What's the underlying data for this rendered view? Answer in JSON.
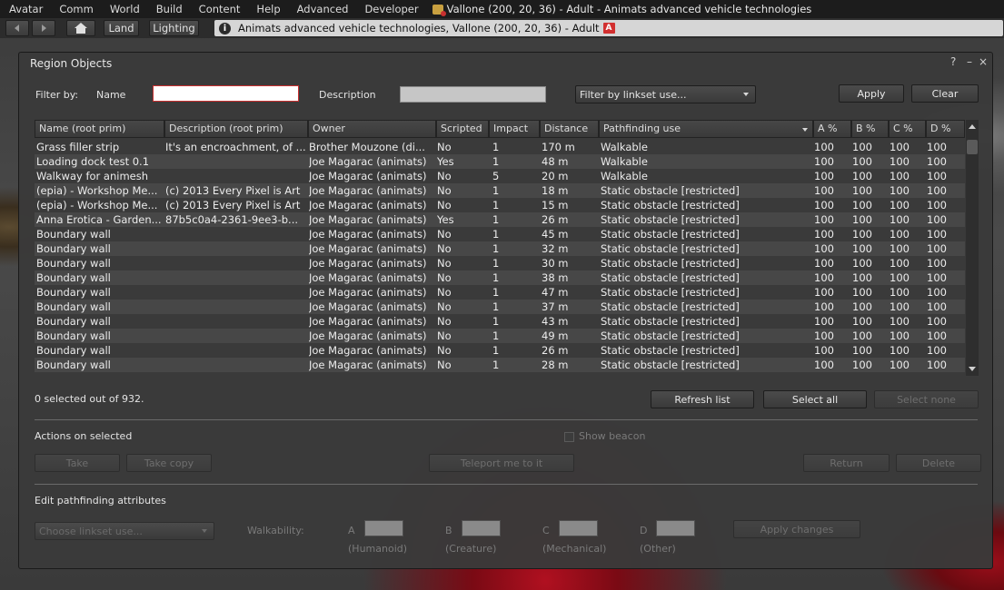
{
  "menu": [
    "Avatar",
    "Comm",
    "World",
    "Build",
    "Content",
    "Help",
    "Advanced",
    "Developer"
  ],
  "location_title": "Vallone (200, 20, 36) - Adult - Animats advanced vehicle technologies",
  "navbar": {
    "land_label": "Land",
    "lighting_label": "Lighting",
    "address": "Animats advanced vehicle technologies, Vallone (200, 20, 36) - Adult",
    "maturity_badge": "A"
  },
  "window": {
    "title": "Region Objects",
    "help": "?",
    "minimize": "–",
    "close": "×"
  },
  "filter": {
    "filter_by_label": "Filter by:",
    "name_label": "Name",
    "name_value": "",
    "description_label": "Description",
    "description_value": "",
    "linkset_use": "Filter by linkset use...",
    "apply_label": "Apply",
    "clear_label": "Clear"
  },
  "table": {
    "columns": [
      "Name (root prim)",
      "Description (root prim)",
      "Owner",
      "Scripted",
      "Impact",
      "Distance",
      "Pathfinding use",
      "A %",
      "B %",
      "C %",
      "D %"
    ],
    "rows": [
      [
        "Grass filler strip",
        "It's an encroachment, of ...",
        "Brother Mouzone (di...",
        "No",
        "1",
        "170 m",
        "Walkable",
        "100",
        "100",
        "100",
        "100"
      ],
      [
        "Loading dock test 0.1",
        "",
        "Joe Magarac (animats)",
        "Yes",
        "1",
        "48 m",
        "Walkable",
        "100",
        "100",
        "100",
        "100"
      ],
      [
        "Walkway for animesh",
        "",
        "Joe Magarac (animats)",
        "No",
        "5",
        "20 m",
        "Walkable",
        "100",
        "100",
        "100",
        "100"
      ],
      [
        "(epia) - Workshop Me...",
        "(c) 2013 Every Pixel is Art",
        "Joe Magarac (animats)",
        "No",
        "1",
        "18 m",
        "Static obstacle [restricted]",
        "100",
        "100",
        "100",
        "100"
      ],
      [
        "(epia) - Workshop Me...",
        "(c) 2013 Every Pixel is Art",
        "Joe Magarac (animats)",
        "No",
        "1",
        "15 m",
        "Static obstacle [restricted]",
        "100",
        "100",
        "100",
        "100"
      ],
      [
        "Anna Erotica - Garden...",
        "87b5c0a4-2361-9ee3-b...",
        "Joe Magarac (animats)",
        "Yes",
        "1",
        "26 m",
        "Static obstacle [restricted]",
        "100",
        "100",
        "100",
        "100"
      ],
      [
        "Boundary wall",
        "",
        "Joe Magarac (animats)",
        "No",
        "1",
        "45 m",
        "Static obstacle [restricted]",
        "100",
        "100",
        "100",
        "100"
      ],
      [
        "Boundary wall",
        "",
        "Joe Magarac (animats)",
        "No",
        "1",
        "32 m",
        "Static obstacle [restricted]",
        "100",
        "100",
        "100",
        "100"
      ],
      [
        "Boundary wall",
        "",
        "Joe Magarac (animats)",
        "No",
        "1",
        "30 m",
        "Static obstacle [restricted]",
        "100",
        "100",
        "100",
        "100"
      ],
      [
        "Boundary wall",
        "",
        "Joe Magarac (animats)",
        "No",
        "1",
        "38 m",
        "Static obstacle [restricted]",
        "100",
        "100",
        "100",
        "100"
      ],
      [
        "Boundary wall",
        "",
        "Joe Magarac (animats)",
        "No",
        "1",
        "47 m",
        "Static obstacle [restricted]",
        "100",
        "100",
        "100",
        "100"
      ],
      [
        "Boundary wall",
        "",
        "Joe Magarac (animats)",
        "No",
        "1",
        "37 m",
        "Static obstacle [restricted]",
        "100",
        "100",
        "100",
        "100"
      ],
      [
        "Boundary wall",
        "",
        "Joe Magarac (animats)",
        "No",
        "1",
        "43 m",
        "Static obstacle [restricted]",
        "100",
        "100",
        "100",
        "100"
      ],
      [
        "Boundary wall",
        "",
        "Joe Magarac (animats)",
        "No",
        "1",
        "49 m",
        "Static obstacle [restricted]",
        "100",
        "100",
        "100",
        "100"
      ],
      [
        "Boundary wall",
        "",
        "Joe Magarac (animats)",
        "No",
        "1",
        "26 m",
        "Static obstacle [restricted]",
        "100",
        "100",
        "100",
        "100"
      ],
      [
        "Boundary wall",
        "",
        "Joe Magarac (animats)",
        "No",
        "1",
        "28 m",
        "Static obstacle [restricted]",
        "100",
        "100",
        "100",
        "100"
      ]
    ]
  },
  "selection": {
    "status": "0 selected out of 932.",
    "refresh_label": "Refresh list",
    "select_all_label": "Select all",
    "select_none_label": "Select none"
  },
  "actions": {
    "heading": "Actions on selected",
    "show_beacon_label": "Show beacon",
    "take_label": "Take",
    "take_copy_label": "Take copy",
    "teleport_label": "Teleport me to it",
    "return_label": "Return",
    "delete_label": "Delete"
  },
  "pathfinding": {
    "heading": "Edit pathfinding attributes",
    "linkset_use": "Choose linkset use...",
    "walkability_label": "Walkability:",
    "a_label": "A",
    "a_caption": "(Humanoid)",
    "b_label": "B",
    "b_caption": "(Creature)",
    "c_label": "C",
    "c_caption": "(Mechanical)",
    "d_label": "D",
    "d_caption": "(Other)",
    "apply_changes_label": "Apply changes"
  }
}
